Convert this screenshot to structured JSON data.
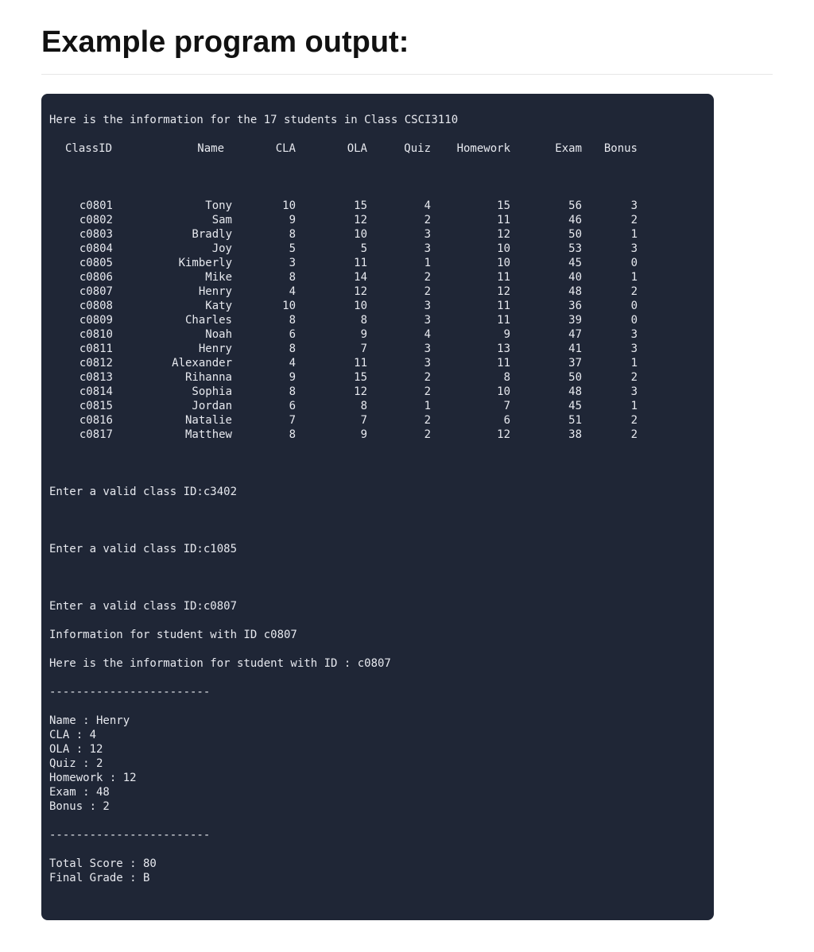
{
  "heading": "Example program output:",
  "terminal": {
    "intro_line": "Here is the information for the 17 students in Class CSCI3110",
    "columns": [
      "ClassID",
      "Name",
      "CLA",
      "OLA",
      "Quiz",
      "Homework",
      "Exam",
      "Bonus"
    ],
    "rows": [
      {
        "id": "c0801",
        "name": "Tony",
        "cla": 10,
        "ola": 15,
        "quiz": 4,
        "hw": 15,
        "exam": 56,
        "bonus": 3
      },
      {
        "id": "c0802",
        "name": "Sam",
        "cla": 9,
        "ola": 12,
        "quiz": 2,
        "hw": 11,
        "exam": 46,
        "bonus": 2
      },
      {
        "id": "c0803",
        "name": "Bradly",
        "cla": 8,
        "ola": 10,
        "quiz": 3,
        "hw": 12,
        "exam": 50,
        "bonus": 1
      },
      {
        "id": "c0804",
        "name": "Joy",
        "cla": 5,
        "ola": 5,
        "quiz": 3,
        "hw": 10,
        "exam": 53,
        "bonus": 3
      },
      {
        "id": "c0805",
        "name": "Kimberly",
        "cla": 3,
        "ola": 11,
        "quiz": 1,
        "hw": 10,
        "exam": 45,
        "bonus": 0
      },
      {
        "id": "c0806",
        "name": "Mike",
        "cla": 8,
        "ola": 14,
        "quiz": 2,
        "hw": 11,
        "exam": 40,
        "bonus": 1
      },
      {
        "id": "c0807",
        "name": "Henry",
        "cla": 4,
        "ola": 12,
        "quiz": 2,
        "hw": 12,
        "exam": 48,
        "bonus": 2
      },
      {
        "id": "c0808",
        "name": "Katy",
        "cla": 10,
        "ola": 10,
        "quiz": 3,
        "hw": 11,
        "exam": 36,
        "bonus": 0
      },
      {
        "id": "c0809",
        "name": "Charles",
        "cla": 8,
        "ola": 8,
        "quiz": 3,
        "hw": 11,
        "exam": 39,
        "bonus": 0
      },
      {
        "id": "c0810",
        "name": "Noah",
        "cla": 6,
        "ola": 9,
        "quiz": 4,
        "hw": 9,
        "exam": 47,
        "bonus": 3
      },
      {
        "id": "c0811",
        "name": "Henry",
        "cla": 8,
        "ola": 7,
        "quiz": 3,
        "hw": 13,
        "exam": 41,
        "bonus": 3
      },
      {
        "id": "c0812",
        "name": "Alexander",
        "cla": 4,
        "ola": 11,
        "quiz": 3,
        "hw": 11,
        "exam": 37,
        "bonus": 1
      },
      {
        "id": "c0813",
        "name": "Rihanna",
        "cla": 9,
        "ola": 15,
        "quiz": 2,
        "hw": 8,
        "exam": 50,
        "bonus": 2
      },
      {
        "id": "c0814",
        "name": "Sophia",
        "cla": 8,
        "ola": 12,
        "quiz": 2,
        "hw": 10,
        "exam": 48,
        "bonus": 3
      },
      {
        "id": "c0815",
        "name": "Jordan",
        "cla": 6,
        "ola": 8,
        "quiz": 1,
        "hw": 7,
        "exam": 45,
        "bonus": 1
      },
      {
        "id": "c0816",
        "name": "Natalie",
        "cla": 7,
        "ola": 7,
        "quiz": 2,
        "hw": 6,
        "exam": 51,
        "bonus": 2
      },
      {
        "id": "c0817",
        "name": "Matthew",
        "cla": 8,
        "ola": 9,
        "quiz": 2,
        "hw": 12,
        "exam": 38,
        "bonus": 2
      }
    ],
    "prompts": [
      "Enter a valid class ID:c3402",
      "Enter a valid class ID:c1085",
      "Enter a valid class ID:c0807"
    ],
    "detail_header_1": "Information for student with ID c0807",
    "detail_header_2": "Here is the information for student with ID : c0807",
    "sep": "------------------------",
    "detail_lines": [
      "Name : Henry",
      "CLA : 4",
      "OLA : 12",
      "Quiz : 2",
      "Homework : 12",
      "Exam : 48",
      "Bonus : 2"
    ],
    "totals": [
      "Total Score : 80",
      "Final Grade : B"
    ]
  }
}
